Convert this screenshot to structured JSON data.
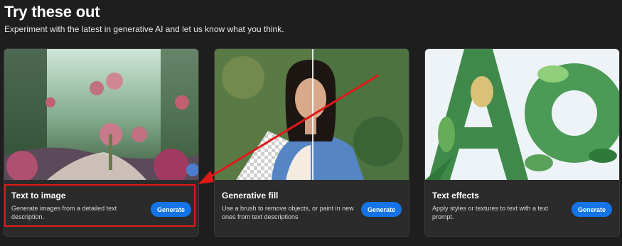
{
  "header": {
    "title": "Try these out",
    "subtitle": "Experiment with the latest in generative AI and let us know what you think."
  },
  "cards": [
    {
      "title": "Text to image",
      "description": "Generate images from a detailed text description.",
      "button_label": "Generate",
      "image_icon": "fantasy-garden-image"
    },
    {
      "title": "Generative fill",
      "description": "Use a brush to remove objects, or paint in new ones from text descriptions",
      "button_label": "Generate",
      "image_icon": "woman-portrait-image"
    },
    {
      "title": "Text effects",
      "description": "Apply styles or textures to text with a text prompt.",
      "button_label": "Generate",
      "image_icon": "leaf-letters-image"
    }
  ],
  "annotation": {
    "highlight_color": "#e01818"
  },
  "colors": {
    "background": "#1e1e1e",
    "card": "#2b2b2b",
    "accent": "#1473e6"
  }
}
